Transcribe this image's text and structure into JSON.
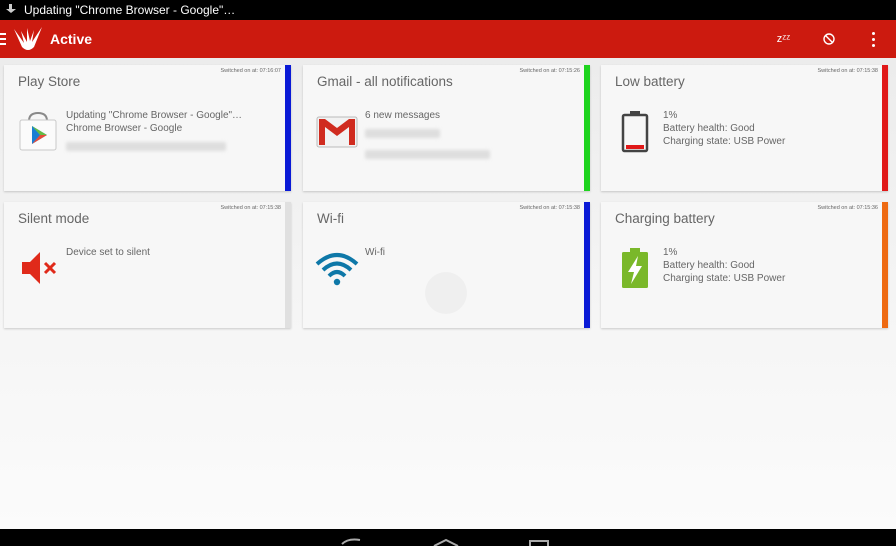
{
  "status_bar": {
    "notification_text": "Updating \"Chrome Browser - Google\"…",
    "icon": "download-icon"
  },
  "action_bar": {
    "title": "Active",
    "logo": "bird-logo",
    "actions": [
      {
        "name": "snooze",
        "label": "zᶻᶻ",
        "icon": "snooze-icon"
      },
      {
        "name": "block",
        "label": "⦸",
        "icon": "block-icon"
      },
      {
        "name": "overflow",
        "icon": "overflow-menu-icon"
      }
    ],
    "color": "#cc1a0f"
  },
  "cards": [
    {
      "title": "Play Store",
      "switched": "Switched on at: 07:16:07",
      "stripe_color": "#0a1ad6",
      "icon": "play-store-icon",
      "lines": [
        "Updating \"Chrome Browser - Google\"…",
        "Chrome Browser - Google"
      ]
    },
    {
      "title": "Gmail - all notifications",
      "switched": "Switched on at: 07:15:26",
      "stripe_color": "#1ed41e",
      "icon": "gmail-icon",
      "lines": [
        "6 new messages"
      ]
    },
    {
      "title": "Low battery",
      "switched": "Switched on at: 07:15:38",
      "stripe_color": "#e01818",
      "icon": "low-battery-icon",
      "lines": [
        "1%",
        "Battery health: Good",
        "Charging state: USB Power"
      ]
    },
    {
      "title": "Silent mode",
      "switched": "Switched on at: 07:15:38",
      "stripe_color": "#e0e0e0",
      "icon": "speaker-muted-icon",
      "lines": [
        "Device set to silent"
      ]
    },
    {
      "title": "Wi-fi",
      "switched": "Switched on at: 07:15:38",
      "stripe_color": "#0a1ad6",
      "icon": "wifi-icon",
      "lines": [
        "Wi-fi"
      ]
    },
    {
      "title": "Charging battery",
      "switched": "Switched on at: 07:15:36",
      "stripe_color": "#ee6a12",
      "icon": "charging-battery-icon",
      "lines": [
        "1%",
        "Battery health: Good",
        "Charging state: USB Power"
      ]
    }
  ],
  "nav_bar": {
    "buttons": [
      "back-icon",
      "home-icon",
      "recents-icon"
    ]
  }
}
